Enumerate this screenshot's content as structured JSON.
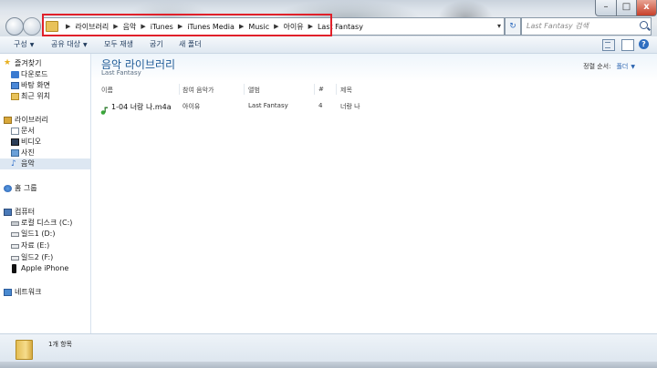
{
  "window": {
    "controls": {
      "minimize": "–",
      "maximize": "□",
      "close": "x"
    }
  },
  "address_bar": {
    "crumbs": [
      "라이브러리",
      "음악",
      "iTunes",
      "iTunes Media",
      "Music",
      "아이유",
      "Last Fantasy"
    ],
    "dropdown_glyph": "▾",
    "refresh_glyph": "↻"
  },
  "search": {
    "placeholder": "Last Fantasy 검색"
  },
  "toolbar": {
    "items": [
      "구성",
      "공유 대상",
      "모두 재생",
      "굽기",
      "새 폴더"
    ],
    "help": "?"
  },
  "sidebar": {
    "favorites": {
      "title": "즐겨찾기",
      "items": [
        "다운로드",
        "바탕 화면",
        "최근 위치"
      ]
    },
    "libraries": {
      "title": "라이브러리",
      "items": [
        "문서",
        "비디오",
        "사진",
        "음악"
      ],
      "selected": "음악"
    },
    "homegroup": {
      "title": "홈 그룹"
    },
    "computer": {
      "title": "컴퓨터",
      "items": [
        "로컬 디스크 (C:)",
        "일드1 (D:)",
        "자료 (E:)",
        "일드2 (F:)",
        "Apple iPhone"
      ]
    },
    "network": {
      "title": "네트워크"
    }
  },
  "library": {
    "title": "음악 라이브러리",
    "subtitle": "Last Fantasy",
    "arrange_label": "정렬 순서:",
    "arrange_value": "폴더"
  },
  "columns": [
    "이름",
    "참여 음악가",
    "앨범",
    "#",
    "제목"
  ],
  "files": [
    {
      "name": "1-04 너랑 나.m4a",
      "artist": "아이유",
      "album": "Last Fantasy",
      "track": "4",
      "title": "너랑 나"
    }
  ],
  "status": {
    "count_text": "1개 항목"
  },
  "colors": {
    "accent": "#1e5a96",
    "highlight_box": "#e0202a",
    "selected_nav": "#dde7f2"
  }
}
